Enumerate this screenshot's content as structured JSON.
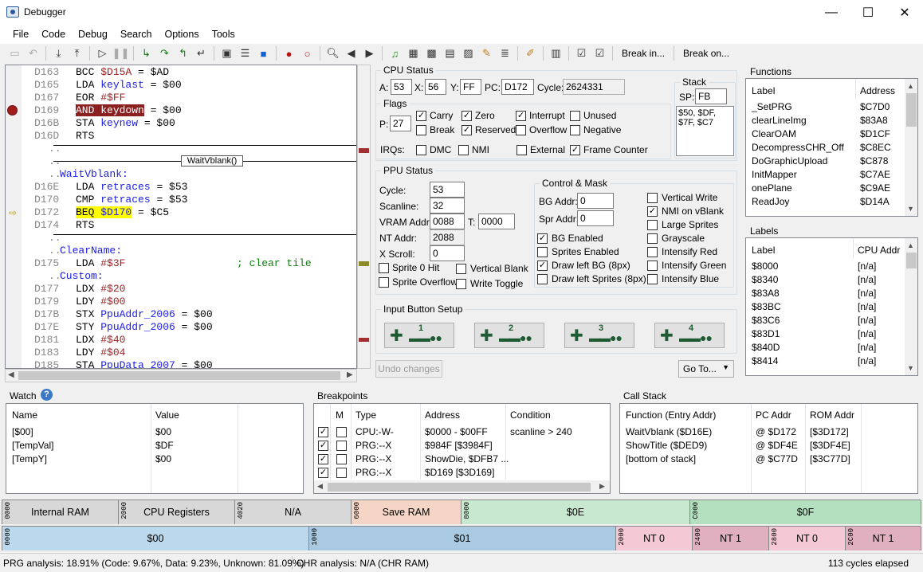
{
  "window": {
    "title": "Debugger",
    "minimize": "—",
    "maximize": "☐",
    "close": "✕"
  },
  "menu": [
    "File",
    "Code",
    "Debug",
    "Search",
    "Options",
    "Tools"
  ],
  "toolbar": {
    "break_in": "Break in...",
    "break_on": "Break on..."
  },
  "code": {
    "lines": [
      {
        "addr": "D163",
        "mn": "BCC",
        "arg": "$D15A",
        "rest": " = $AD"
      },
      {
        "addr": "D165",
        "mn": "LDA",
        "arg": "keylast",
        "rest": " = $00"
      },
      {
        "addr": "D167",
        "mn": "EOR",
        "arg": "#$FF",
        "rest": ""
      },
      {
        "addr": "D169",
        "mn": "AND",
        "arg": "keydown",
        "rest": " = $00"
      },
      {
        "addr": "D16B",
        "mn": "STA",
        "arg": "keynew",
        "rest": " = $00"
      },
      {
        "addr": "D16D",
        "mn": "RTS",
        "arg": "",
        "rest": ""
      },
      {
        "addr": "D16E",
        "mn": "LDA",
        "arg": "retraces",
        "rest": " = $53"
      },
      {
        "addr": "D170",
        "mn": "CMP",
        "arg": "retraces",
        "rest": " = $53"
      },
      {
        "addr": "D172",
        "mn": "BEQ",
        "arg": "$D170",
        "rest": " = $C5"
      },
      {
        "addr": "D174",
        "mn": "RTS",
        "arg": "",
        "rest": ""
      },
      {
        "addr": "D175",
        "mn": "LDA",
        "arg": "#$3F",
        "rest": ""
      },
      {
        "addr": "D177",
        "mn": "LDX",
        "arg": "#$20",
        "rest": ""
      },
      {
        "addr": "D179",
        "mn": "LDY",
        "arg": "#$00",
        "rest": ""
      },
      {
        "addr": "D17B",
        "mn": "STX",
        "arg": "PpuAddr_2006",
        "rest": " = $00"
      },
      {
        "addr": "D17E",
        "mn": "STY",
        "arg": "PpuAddr_2006",
        "rest": " = $00"
      },
      {
        "addr": "D181",
        "mn": "LDX",
        "arg": "#$40",
        "rest": ""
      },
      {
        "addr": "D183",
        "mn": "LDY",
        "arg": "#$04",
        "rest": ""
      },
      {
        "addr": "D185",
        "mn": "STA",
        "arg": "PpuData_2007",
        "rest": " = $00"
      }
    ],
    "labels": {
      "waitvblank": "WaitVblank:",
      "clearname": "ClearName:",
      "custom": "Custom:"
    },
    "func_box": "WaitVblank()",
    "comment": "; clear tile",
    "dots": ".."
  },
  "cpu": {
    "title": "CPU Status",
    "a_label": "A:",
    "a": "53",
    "x_label": "X:",
    "x": "56",
    "y_label": "Y:",
    "y": "FF",
    "pc_label": "PC:",
    "pc": "D172",
    "cycle_label": "Cycle:",
    "cycle": "2624331",
    "flags_title": "Flags",
    "p_label": "P:",
    "p": "27",
    "flags": [
      {
        "label": "Carry",
        "on": true
      },
      {
        "label": "Zero",
        "on": true
      },
      {
        "label": "Interrupt",
        "on": true
      },
      {
        "label": "Unused",
        "on": false
      },
      {
        "label": "Break",
        "on": false
      },
      {
        "label": "Reserved",
        "on": true
      },
      {
        "label": "Overflow",
        "on": false
      },
      {
        "label": "Negative",
        "on": false
      }
    ],
    "irq_label": "IRQs:",
    "irqs": [
      {
        "label": "DMC",
        "on": false
      },
      {
        "label": "NMI",
        "on": false
      },
      {
        "label": "External",
        "on": false
      },
      {
        "label": "Frame Counter",
        "on": true
      }
    ],
    "stack_title": "Stack",
    "sp_label": "SP:",
    "sp": "FB",
    "stack_values": "$50, $DF,\n$7F, $C7"
  },
  "ppu": {
    "title": "PPU Status",
    "cycle_label": "Cycle:",
    "cycle": "53",
    "scanline_label": "Scanline:",
    "scanline": "32",
    "vram_label": "VRAM Addr:",
    "vram": "0088",
    "t_label": "T:",
    "t": "0000",
    "nt_label": "NT Addr:",
    "nt": "2088",
    "xscroll_label": "X Scroll:",
    "xscroll": "0",
    "sprite0hit": "Sprite 0 Hit",
    "vblank": "Vertical Blank",
    "spriteoverflow": "Sprite Overflow",
    "writetoggle": "Write Toggle",
    "cm_title": "Control & Mask",
    "bg_addr_label": "BG Addr:",
    "bg_addr": "0",
    "spr_addr_label": "Spr Addr:",
    "spr_addr": "0",
    "cm_left": [
      {
        "label": "BG Enabled",
        "on": true
      },
      {
        "label": "Sprites Enabled",
        "on": false
      },
      {
        "label": "Draw left BG (8px)",
        "on": true
      },
      {
        "label": "Draw left Sprites (8px)",
        "on": false
      }
    ],
    "cm_right": [
      {
        "label": "Vertical Write",
        "on": false
      },
      {
        "label": "NMI on vBlank",
        "on": true
      },
      {
        "label": "Large Sprites",
        "on": false
      },
      {
        "label": "Grayscale",
        "on": false
      },
      {
        "label": "Intensify Red",
        "on": false
      },
      {
        "label": "Intensify Green",
        "on": false
      },
      {
        "label": "Intensify Blue",
        "on": false
      }
    ]
  },
  "input": {
    "title": "Input Button Setup",
    "pads": [
      "1",
      "2",
      "3",
      "4"
    ]
  },
  "undo": "Undo changes",
  "goto": "Go To...",
  "functions": {
    "title": "Functions",
    "col1": "Label",
    "col2": "Address",
    "rows": [
      [
        "_SetPRG",
        "$C7D0"
      ],
      [
        "clearLineImg",
        "$83A8"
      ],
      [
        "ClearOAM",
        "$D1CF"
      ],
      [
        "DecompressCHR_Off",
        "$C8EC"
      ],
      [
        "DoGraphicUpload",
        "$C878"
      ],
      [
        "InitMapper",
        "$C7AE"
      ],
      [
        "onePlane",
        "$C9AE"
      ],
      [
        "ReadJoy",
        "$D14A"
      ]
    ]
  },
  "labels": {
    "title": "Labels",
    "col1": "Label",
    "col2": "CPU Addr",
    "rows": [
      [
        "$8000",
        "[n/a]"
      ],
      [
        "$8340",
        "[n/a]"
      ],
      [
        "$83A8",
        "[n/a]"
      ],
      [
        "$83BC",
        "[n/a]"
      ],
      [
        "$83C6",
        "[n/a]"
      ],
      [
        "$83D1",
        "[n/a]"
      ],
      [
        "$840D",
        "[n/a]"
      ],
      [
        "$8414",
        "[n/a]"
      ]
    ]
  },
  "watch": {
    "title": "Watch",
    "col1": "Name",
    "col2": "Value",
    "rows": [
      [
        "[$00]",
        "$00"
      ],
      [
        "[TempVal]",
        "$DF"
      ],
      [
        "[TempY]",
        "$00"
      ]
    ]
  },
  "breakpoints": {
    "title": "Breakpoints",
    "cols": [
      "M",
      "Type",
      "Address",
      "Condition"
    ],
    "rows": [
      [
        "CPU:-W-",
        "$0000 - $00FF",
        "scanline > 240"
      ],
      [
        "PRG:--X",
        "$984F [$3984F]",
        ""
      ],
      [
        "PRG:--X",
        "ShowDie, $DFB7 ...",
        ""
      ],
      [
        "PRG:--X",
        "$D169 [$3D169]",
        ""
      ]
    ]
  },
  "callstack": {
    "title": "Call Stack",
    "cols": [
      "Function (Entry Addr)",
      "PC Addr",
      "ROM Addr"
    ],
    "rows": [
      [
        "WaitVblank ($D16E)",
        "@ $D172",
        "[$3D172]"
      ],
      [
        "ShowTitle ($DED9)",
        "@ $DF4E",
        "[$3DF4E]"
      ],
      [
        "[bottom of stack]",
        "@ $C77D",
        "[$3C77D]"
      ]
    ]
  },
  "memmap1": [
    {
      "start": "0000",
      "label": "Internal RAM",
      "color": "#d8d8d8"
    },
    {
      "start": "2000",
      "label": "CPU Registers",
      "color": "#d8d8d8"
    },
    {
      "start": "4020",
      "label": "N/A",
      "color": "#d8d8d8"
    },
    {
      "start": "6000",
      "label": "Save RAM",
      "color": "#f5d5c5"
    },
    {
      "start": "8000",
      "label": "$0E",
      "color": "#c8e8d0"
    },
    {
      "start": "C000",
      "label": "$0F",
      "color": "#b5e0c0"
    }
  ],
  "memmap2": [
    {
      "start": "0000",
      "label": "$00",
      "color": "#bcd8ec"
    },
    {
      "start": "1000",
      "label": "$01",
      "color": "#a9cae0"
    },
    {
      "start": "2000",
      "label": "NT 0",
      "color": "#f4c8d4"
    },
    {
      "start": "2400",
      "label": "NT 1",
      "color": "#e0b0c0"
    },
    {
      "start": "2800",
      "label": "NT 0",
      "color": "#f4c8d4"
    },
    {
      "start": "2C00",
      "label": "NT 1",
      "color": "#e0b0c0"
    }
  ],
  "status": {
    "prg": "PRG analysis:  18.91% (Code: 9.67%, Data: 9.23%, Unknown: 81.09%)",
    "chr": "CHR analysis:  N/A (CHR RAM)",
    "cycles": "113 cycles elapsed"
  }
}
